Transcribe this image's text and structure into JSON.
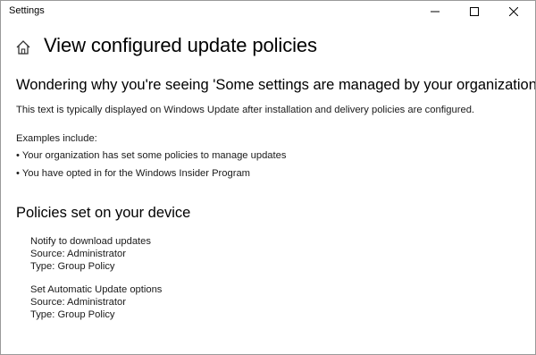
{
  "window": {
    "title": "Settings",
    "controls": {
      "minimize_icon": "minimize-icon",
      "maximize_icon": "maximize-icon",
      "close_icon": "close-icon"
    }
  },
  "header": {
    "home_icon": "home-icon",
    "title": "View configured update policies"
  },
  "info": {
    "heading": "Wondering why you're seeing 'Some settings are managed by your organization'?",
    "description": "This text is typically displayed on Windows Update after installation and delivery policies are configured.",
    "examples_label": "Examples include:",
    "examples": [
      "• Your organization has set some policies to manage updates",
      "• You have opted in for the Windows Insider Program"
    ]
  },
  "policies": {
    "heading": "Policies set on your device",
    "items": [
      {
        "name": "Notify to download updates",
        "source": "Source: Administrator",
        "type": "Type: Group Policy"
      },
      {
        "name": "Set Automatic Update options",
        "source": "Source: Administrator",
        "type": "Type: Group Policy"
      }
    ]
  },
  "colors": {
    "text": "#1a1a1a",
    "window_border": "#9a9a9a",
    "background": "#ffffff"
  }
}
